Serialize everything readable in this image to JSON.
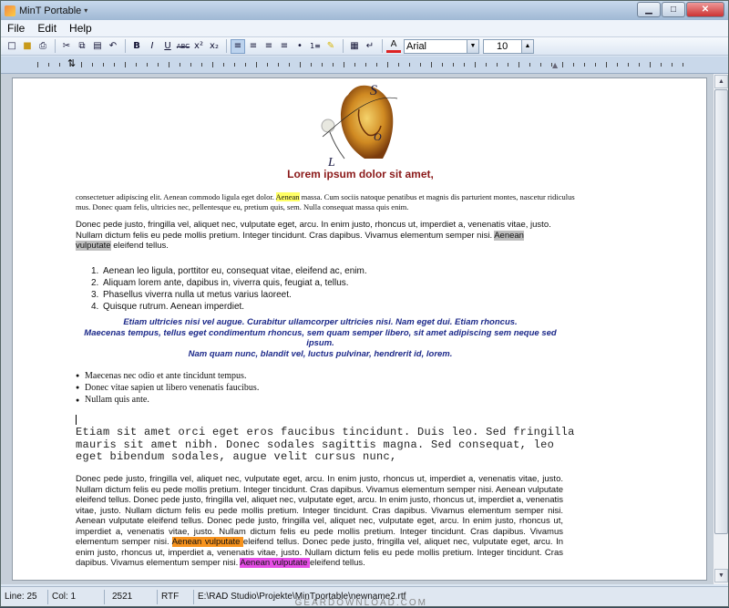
{
  "window": {
    "title": "MinT Portable",
    "caret": "▾",
    "minimize": "▁",
    "maximize": "□",
    "close": "✕"
  },
  "menu": [
    "File",
    "Edit",
    "Help"
  ],
  "toolbar": {
    "font_name": "Arial",
    "font_size": "10"
  },
  "document": {
    "logo_letters": {
      "s": "S",
      "o": "O",
      "l": "L"
    },
    "heading": "Lorem ipsum dolor sit amet,",
    "p1_before": "consectetuer adipiscing elit. Aenean commodo ligula eget dolor. ",
    "p1_highlight": "Aenean",
    "p1_after": " massa. Cum sociis natoque penatibus et magnis dis parturient montes, nascetur ridiculus mus. Donec quam felis, ultricies nec, pellentesque eu, pretium quis, sem. Nulla consequat massa quis enim.",
    "p2_before": "Donec pede justo, fringilla vel, aliquet nec, vulputate eget, arcu. In enim justo, rhoncus ut, imperdiet a, venenatis vitae, justo. Nullam dictum felis eu pede mollis pretium. Integer tincidunt. Cras dapibus. Vivamus elementum semper nisi. ",
    "p2_highlight": "Aenean vulputate",
    "p2_after": " eleifend tellus.",
    "ordered_list": [
      {
        "num": "1.",
        "text": "Aenean leo ligula, porttitor eu, consequat vitae, eleifend ac, enim."
      },
      {
        "num": "2.",
        "text": "Aliquam lorem ante, dapibus in, viverra quis, feugiat a, tellus."
      },
      {
        "num": "3.",
        "text": "Phasellus viverra nulla ut metus varius laoreet."
      },
      {
        "num": "4.",
        "text": "Quisque rutrum. Aenean imperdiet."
      }
    ],
    "quote_lines": [
      "Etiam ultricies nisi vel augue. Curabitur ullamcorper ultricies nisi. Nam eget dui. Etiam rhoncus.",
      "Maecenas tempus, tellus eget condimentum rhoncus, sem quam semper libero, sit amet adipiscing sem neque sed ipsum.",
      "Nam quam nunc, blandit vel, luctus pulvinar, hendrerit id, lorem."
    ],
    "bullet_list": [
      "Maecenas nec odio et ante tincidunt tempus.",
      "Donec vitae sapien ut libero venenatis faucibus.",
      "Nullam quis ante."
    ],
    "mono_text": "Etiam sit amet orci eget eros faucibus tincidunt. Duis leo. Sed fringilla mauris sit amet nibh. Donec sodales sagittis magna. Sed consequat, leo eget bibendum sodales, augue velit cursus nunc,",
    "p_last_1": "Donec pede justo, fringilla vel, aliquet nec, vulputate eget, arcu. In enim justo, rhoncus ut, imperdiet a, venenatis vitae, justo. Nullam dictum felis eu pede mollis pretium. Integer tincidunt. Cras dapibus. Vivamus elementum semper nisi. Aenean vulputate eleifend tellus. Donec pede justo, fringilla vel, aliquet nec, vulputate eget, arcu. In enim justo, rhoncus ut, imperdiet a, venenatis vitae, justo. Nullam dictum felis eu pede mollis pretium. Integer tincidunt. Cras dapibus. Vivamus elementum semper nisi. Aenean vulputate eleifend tellus. Donec pede justo, fringilla vel, aliquet nec, vulputate eget, arcu. In enim justo, rhoncus ut, imperdiet a, venenatis vitae, justo. Nullam dictum felis eu pede mollis pretium. Integer tincidunt. Cras dapibus. Vivamus elementum semper nisi. ",
    "p_last_hl1": "Aenean vulputate ",
    "p_last_2": "eleifend tellus.  Donec pede justo, fringilla vel, aliquet nec, vulputate eget, arcu. In enim justo, rhoncus ut, imperdiet a, venenatis vitae, justo. Nullam dictum felis eu pede mollis pretium. Integer tincidunt. Cras dapibus. Vivamus elementum semper nisi. ",
    "p_last_hl2": "Aenean vulputate ",
    "p_last_3": "eleifend tellus."
  },
  "status": {
    "line": "Line: 25",
    "col": "Col: 1",
    "chars": "2521",
    "format": "RTF",
    "path": "E:\\RAD Studio\\Projekte\\MinTportable\\newname2.rtf"
  },
  "watermark": "GEARDOWNLOAD.COM",
  "colors": {
    "heading": "#8b1a1a",
    "quote": "#1d2a8a",
    "highlight_yellow": "#ffff66",
    "highlight_gray": "#bfbfbf",
    "highlight_orange": "#f7931e",
    "highlight_magenta": "#e64ee6"
  }
}
